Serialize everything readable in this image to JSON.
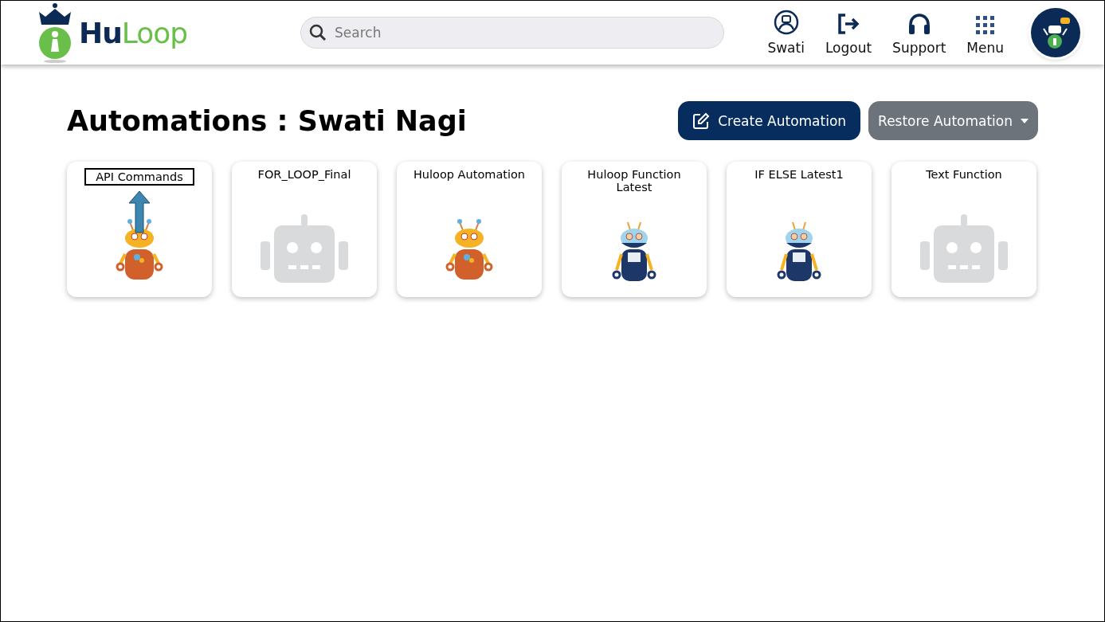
{
  "header": {
    "logo": "**Hu**Loop",
    "search": {
      "placeholder": "Search"
    },
    "nav": [
      {
        "label": "Swati",
        "kind": "user"
      },
      {
        "label": "Logout",
        "kind": "logout"
      },
      {
        "label": "Support",
        "kind": "support"
      },
      {
        "label": "Menu",
        "kind": "menu"
      }
    ]
  },
  "page": {
    "title": "Automations : Swati Nagi",
    "buttons": [
      {
        "label": "Create Automation",
        "kind": "primary"
      },
      {
        "label": "Restore Automation",
        "kind": "dropdown"
      }
    ]
  },
  "automations": [
    {
      "name": "API Commands",
      "kind": "orange",
      "highlighted": true
    },
    {
      "name": "FOR_LOOP_Final",
      "kind": "placeholder",
      "highlighted": false
    },
    {
      "name": "Huloop Automation",
      "kind": "orange",
      "highlighted": false
    },
    {
      "name": "Huloop Function Latest",
      "kind": "blue",
      "highlighted": false
    },
    {
      "name": "IF ELSE Latest1",
      "kind": "blue",
      "highlighted": false
    },
    {
      "name": "Text Function",
      "kind": "placeholder",
      "highlighted": false
    }
  ]
}
